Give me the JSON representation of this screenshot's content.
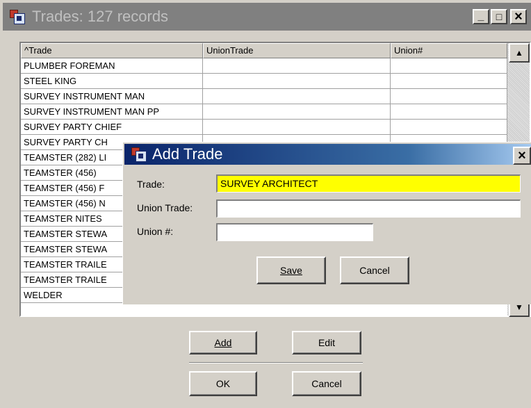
{
  "window": {
    "title": "Trades: 127 records",
    "min_glyph": "_",
    "max_glyph": "□",
    "close_glyph": "×"
  },
  "grid": {
    "columns": [
      "^Trade",
      "UnionTrade",
      "Union#"
    ],
    "rows": [
      [
        "PLUMBER FOREMAN",
        "",
        ""
      ],
      [
        "STEEL KING",
        "",
        ""
      ],
      [
        "SURVEY INSTRUMENT MAN",
        "",
        ""
      ],
      [
        "SURVEY INSTRUMENT MAN PP",
        "",
        ""
      ],
      [
        "SURVEY PARTY CHIEF",
        "",
        ""
      ],
      [
        "SURVEY PARTY CH",
        "",
        ""
      ],
      [
        "TEAMSTER (282) LI",
        "",
        ""
      ],
      [
        "TEAMSTER (456)",
        "",
        ""
      ],
      [
        "TEAMSTER (456)  F",
        "",
        ""
      ],
      [
        "TEAMSTER (456) N",
        "",
        ""
      ],
      [
        "TEAMSTER NITES",
        "",
        ""
      ],
      [
        "TEAMSTER STEWA",
        "",
        ""
      ],
      [
        "TEAMSTER STEWA",
        "",
        ""
      ],
      [
        "TEAMSTER TRAILE",
        "",
        ""
      ],
      [
        "TEAMSTER TRAILE",
        "",
        ""
      ],
      [
        "WELDER",
        "",
        ""
      ]
    ],
    "scroll_up_glyph": "▲",
    "scroll_down_glyph": "▼"
  },
  "buttons": {
    "add": "Add",
    "edit": "Edit",
    "ok": "OK",
    "cancel": "Cancel"
  },
  "dialog": {
    "title": "Add Trade",
    "close_glyph": "×",
    "trade_label": "Trade:",
    "trade_value": "SURVEY ARCHITECT",
    "union_trade_label": "Union Trade:",
    "union_trade_value": "",
    "union_num_label": "Union #:",
    "union_num_value": "",
    "save": "Save",
    "cancel": "Cancel",
    "trade_field_color": "#ffff00",
    "title_color": "#0a246a"
  }
}
